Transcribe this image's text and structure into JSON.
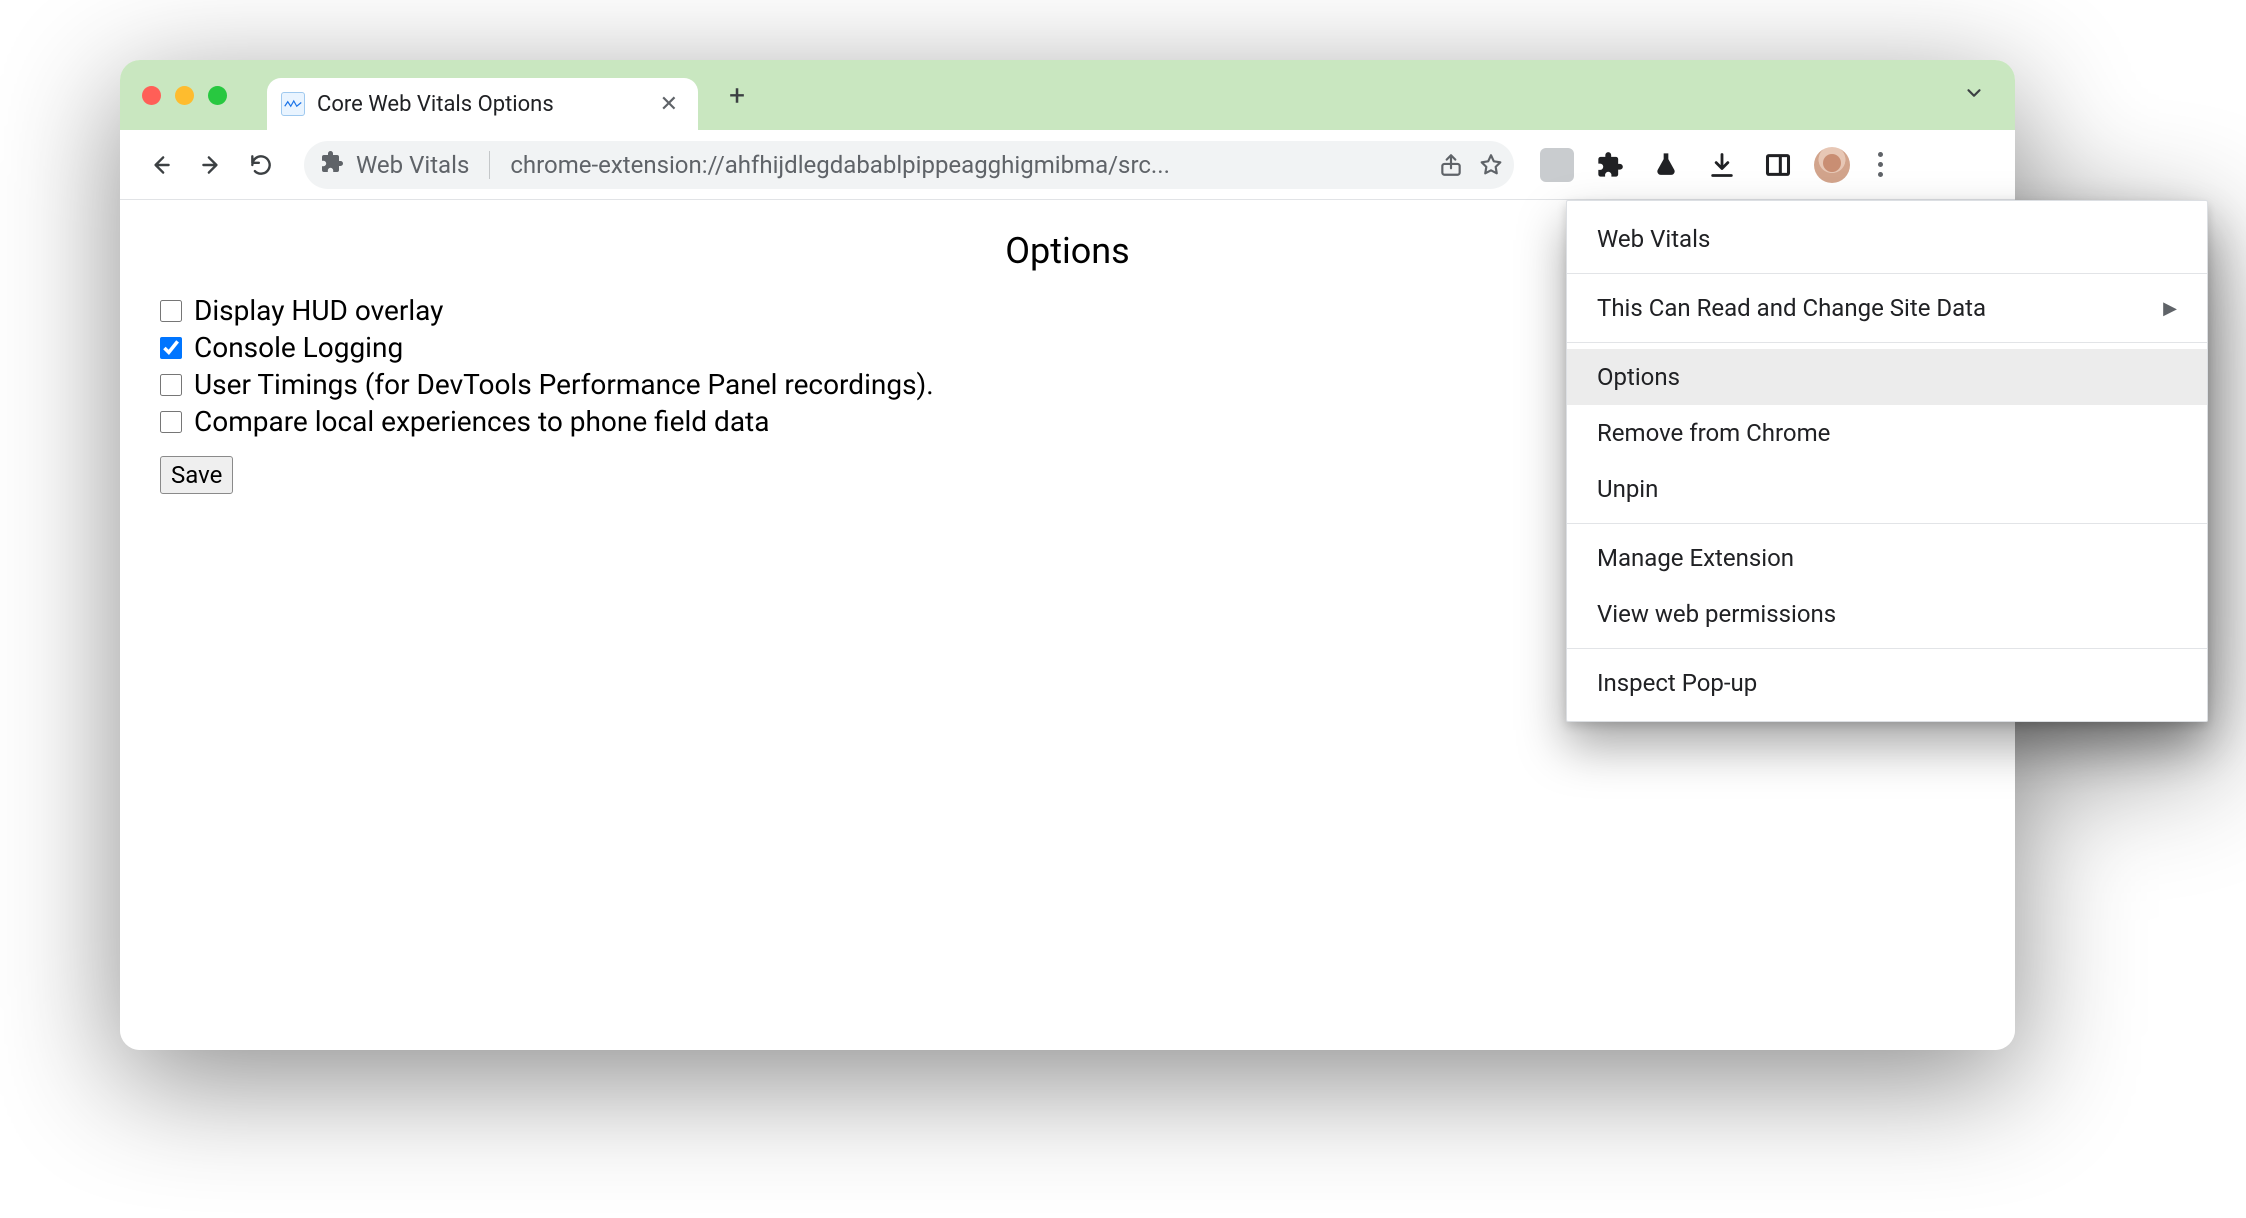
{
  "tab": {
    "title": "Core Web Vitals Options"
  },
  "omnibox": {
    "chip_name": "Web Vitals",
    "url": "chrome-extension://ahfhijdlegdabablpippeagghigmibma/src..."
  },
  "page": {
    "title": "Options",
    "options": [
      {
        "label": "Display HUD overlay",
        "checked": false
      },
      {
        "label": "Console Logging",
        "checked": true
      },
      {
        "label": "User Timings (for DevTools Performance Panel recordings).",
        "checked": false
      },
      {
        "label": "Compare local experiences to phone field data",
        "checked": false
      }
    ],
    "save_label": "Save"
  },
  "menu": {
    "header": "Web Vitals",
    "items": [
      {
        "label": "This Can Read and Change Site Data",
        "submenu": true
      },
      {
        "sep": true
      },
      {
        "label": "Options",
        "hovered": true
      },
      {
        "label": "Remove from Chrome"
      },
      {
        "label": "Unpin"
      },
      {
        "sep": true
      },
      {
        "label": "Manage Extension"
      },
      {
        "label": "View web permissions"
      },
      {
        "sep": true
      },
      {
        "label": "Inspect Pop-up"
      }
    ]
  }
}
